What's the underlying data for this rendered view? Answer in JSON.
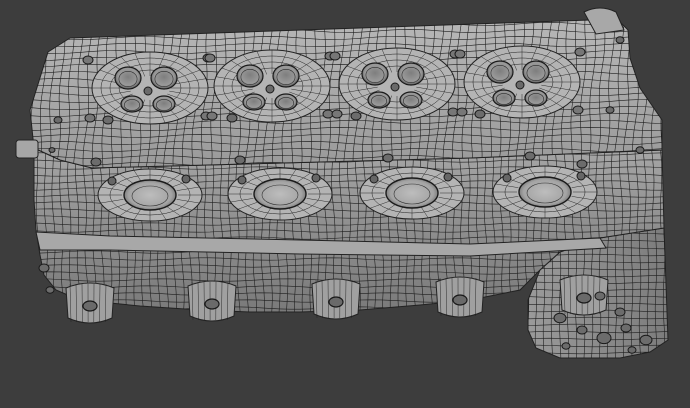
{
  "viewport": {
    "background_color": "#3d3d3d",
    "shading_mode": "solid-wireframe",
    "object": "cylinder-head-mesh",
    "surface_color": "#9c9c9c",
    "surface_light_color": "#b4b4b4",
    "surface_shadow_color": "#6e6e6e",
    "wire_color": "#1e1e1e",
    "cylinder_count": 4,
    "exhaust_port_count": 4,
    "bottom_bolt_boss_count": 5
  }
}
